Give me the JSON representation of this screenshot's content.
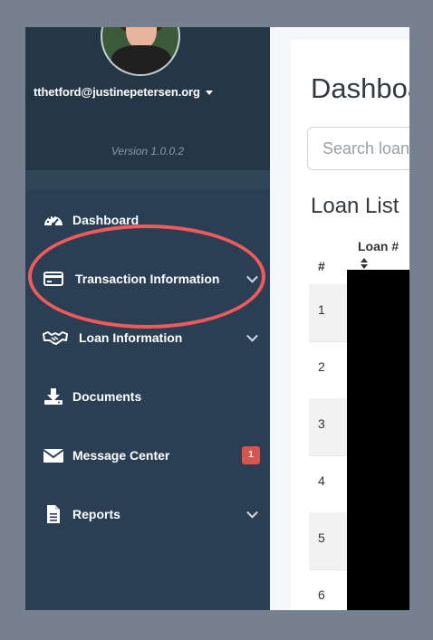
{
  "sidebar": {
    "user_email": "tthetford@justinepetersen.org",
    "version": "Version 1.0.0.2",
    "items": [
      {
        "label": "Dashboard",
        "icon": "dashboard-gauge-icon"
      },
      {
        "label": "Transaction Information",
        "icon": "credit-card-icon",
        "has_submenu": true
      },
      {
        "label": "Loan Information",
        "icon": "handshake-icon",
        "has_submenu": true
      },
      {
        "label": "Documents",
        "icon": "download-icon"
      },
      {
        "label": "Message Center",
        "icon": "envelope-icon",
        "badge": "1"
      },
      {
        "label": "Reports",
        "icon": "file-icon",
        "has_submenu": true
      }
    ]
  },
  "main": {
    "title": "Dashboard",
    "search_placeholder": "Search loans",
    "section_title": "Loan List",
    "table": {
      "headers": [
        "#",
        "Loan #"
      ],
      "rows": [
        "1",
        "2",
        "3",
        "4",
        "5",
        "6"
      ]
    }
  },
  "colors": {
    "sidebar_bg": "#2a3f54",
    "highlight": "#f05a5a",
    "badge": "#d9534f"
  }
}
